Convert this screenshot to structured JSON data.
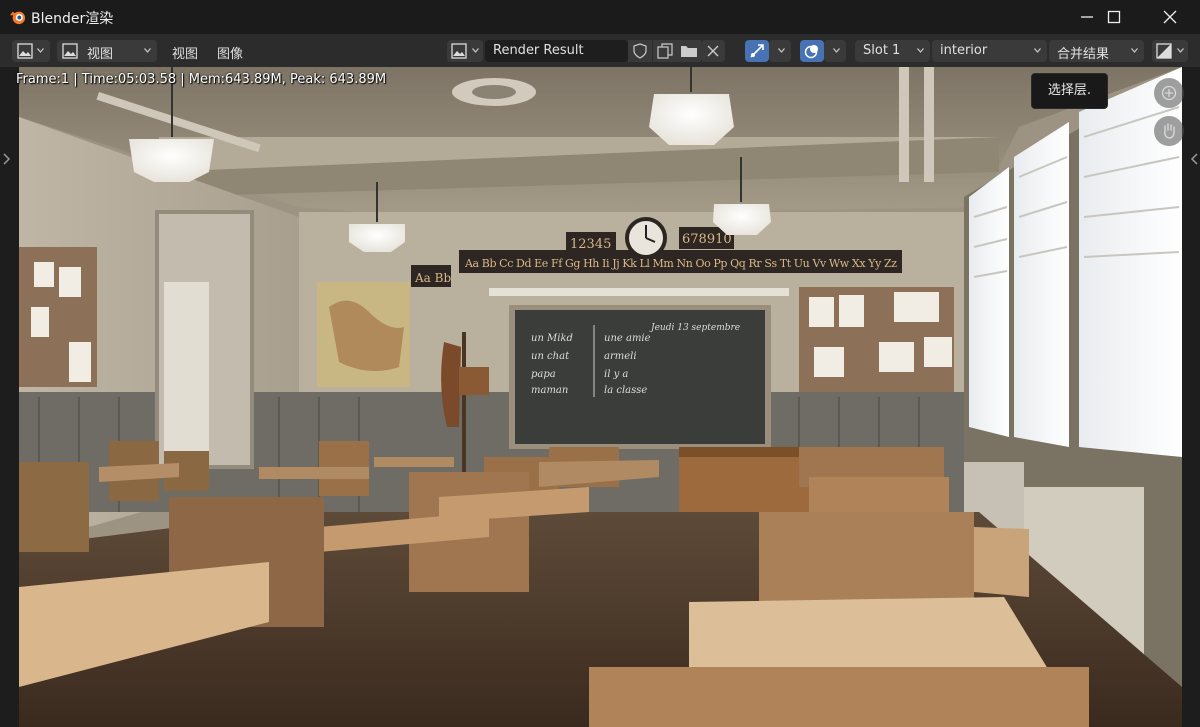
{
  "window": {
    "title": "Blender渲染",
    "logo_icon": "blender-logo-icon",
    "controls": [
      "minimize-icon",
      "maximize-icon",
      "close-icon"
    ]
  },
  "header": {
    "editor_type_icon": "image-editor-icon",
    "mode_label": "视图",
    "menus": [
      "视图",
      "图像"
    ],
    "image_name": "Render Result",
    "slot": "Slot 1",
    "view_layer": "interior",
    "pass": "合并结果",
    "accent": "#4772b3"
  },
  "viewport": {
    "render_stats": "Frame:1 | Time:05:03.58 | Mem:643.89M, Peak: 643.89M",
    "tooltip": "选择层.",
    "nav_icons": [
      "zoom-icon",
      "pan-hand-icon"
    ]
  },
  "scene": {
    "clock_left": "12345",
    "clock_right": "678910",
    "alphabet": "Aa Bb Cc Dd Ee Ff Gg Hh Ii Jj Kk Ll Mm Nn Oo Pp Qq Rr Ss Tt Uu Vv Ww Xx Yy Zz",
    "board_date": "Jeudi 13 septembre",
    "board_col1": [
      "un Mikd",
      "un chat",
      "papa",
      "maman"
    ],
    "board_col2": [
      "une amie",
      "armeli",
      "il y a",
      "la classe"
    ]
  }
}
